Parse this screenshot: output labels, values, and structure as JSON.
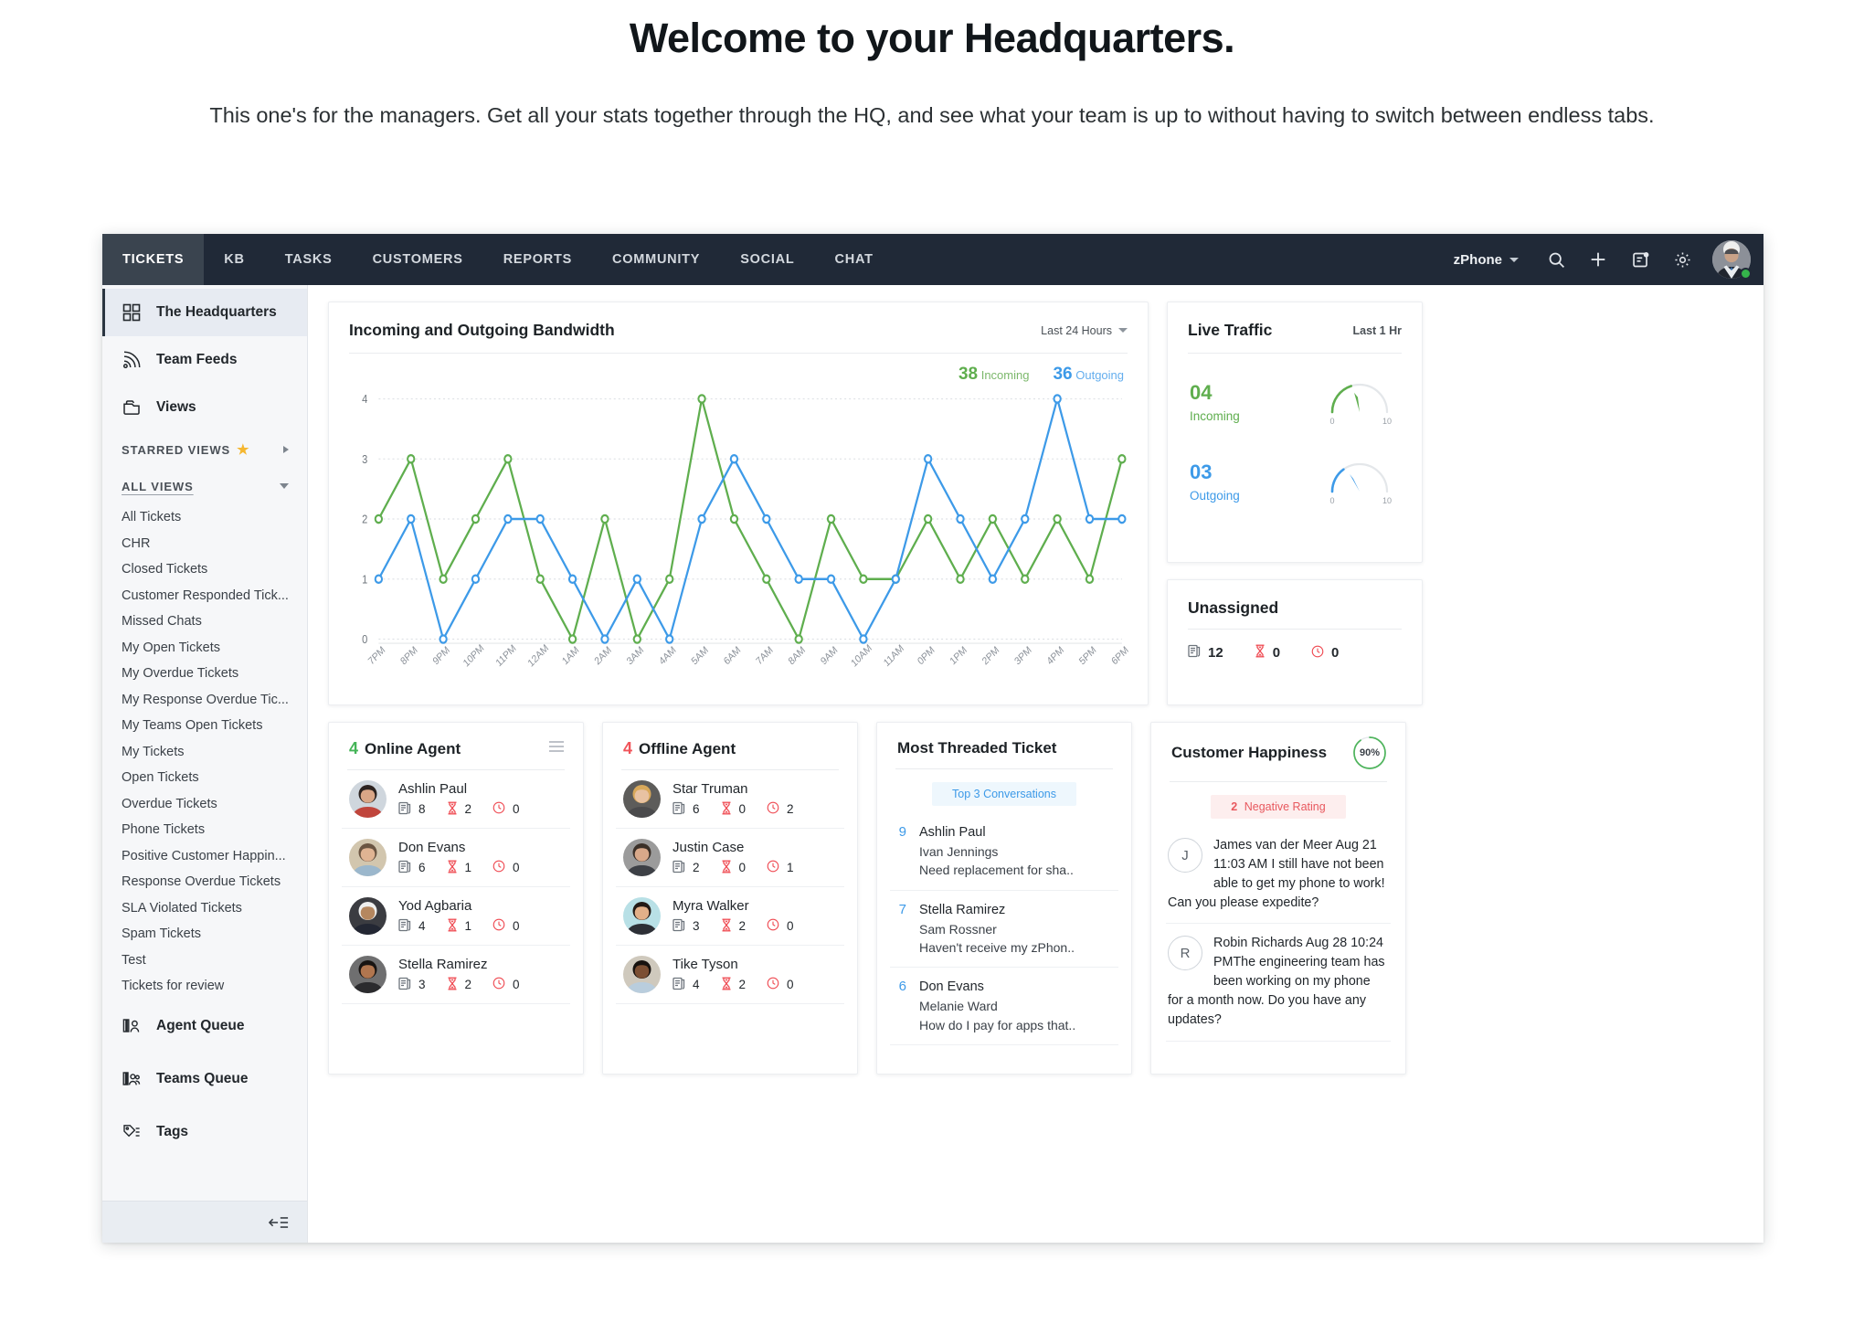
{
  "intro": {
    "title": "Welcome to your Headquarters.",
    "subtitle": "This one's for the managers. Get all your stats together through the HQ, and see what your team is up to without having to switch between endless tabs."
  },
  "topbar": {
    "tabs": [
      {
        "label": "TICKETS",
        "active": true
      },
      {
        "label": "KB",
        "active": false
      },
      {
        "label": "TASKS",
        "active": false
      },
      {
        "label": "CUSTOMERS",
        "active": false
      },
      {
        "label": "REPORTS",
        "active": false
      },
      {
        "label": "COMMUNITY",
        "active": false
      },
      {
        "label": "SOCIAL",
        "active": false
      },
      {
        "label": "CHAT",
        "active": false
      }
    ],
    "brand": "zPhone",
    "icons": [
      "search-icon",
      "plus-icon",
      "notes-icon",
      "gear-icon"
    ],
    "avatar_status": "online"
  },
  "sidebar": {
    "main_items": [
      {
        "label": "The Headquarters",
        "icon": "grid-icon",
        "active": true
      },
      {
        "label": "Team Feeds",
        "icon": "feed-icon",
        "active": false
      },
      {
        "label": "Views",
        "icon": "views-icon",
        "active": false
      }
    ],
    "starred_section": "STARRED VIEWS",
    "all_section": "ALL VIEWS",
    "views": [
      "All Tickets",
      "CHR",
      "Closed Tickets",
      "Customer Responded Tick...",
      "Missed Chats",
      "My Open Tickets",
      "My Overdue Tickets",
      "My Response Overdue Tic...",
      "My Teams Open Tickets",
      "My Tickets",
      "Open Tickets",
      "Overdue Tickets",
      "Phone Tickets",
      "Positive Customer Happin...",
      "Response Overdue Tickets",
      "SLA Violated Tickets",
      "Spam Tickets",
      "Test",
      "Tickets for review"
    ],
    "bottom_items": [
      {
        "label": "Agent Queue",
        "icon": "agent-queue-icon"
      },
      {
        "label": "Teams Queue",
        "icon": "teams-queue-icon"
      },
      {
        "label": "Tags",
        "icon": "tag-icon"
      }
    ],
    "collapse_label": "collapse-sidebar"
  },
  "bandwidth": {
    "title": "Incoming and Outgoing Bandwidth",
    "range": "Last 24 Hours",
    "legend_incoming_value": "38",
    "legend_incoming_label": "Incoming",
    "legend_outgoing_value": "36",
    "legend_outgoing_label": "Outgoing"
  },
  "chart_data": {
    "type": "line",
    "title": "Incoming and Outgoing Bandwidth",
    "xlabel": "",
    "ylabel": "",
    "ylim": [
      0,
      4
    ],
    "yticks": [
      0,
      1,
      2,
      3,
      4
    ],
    "grid": true,
    "legend": "top-right",
    "x": [
      "7PM",
      "8PM",
      "9PM",
      "10PM",
      "11PM",
      "12AM",
      "1AM",
      "2AM",
      "3AM",
      "4AM",
      "5AM",
      "6AM",
      "7AM",
      "8AM",
      "9AM",
      "10AM",
      "11AM",
      "0PM",
      "1PM",
      "2PM",
      "3PM",
      "4PM",
      "5PM",
      "6PM"
    ],
    "series": [
      {
        "name": "Incoming",
        "color": "#5fae4e",
        "total": 38,
        "values": [
          2,
          3,
          1,
          2,
          3,
          1,
          0,
          2,
          0,
          1,
          4,
          2,
          1,
          0,
          2,
          1,
          1,
          2,
          1,
          2,
          1,
          2,
          1,
          3
        ]
      },
      {
        "name": "Outgoing",
        "color": "#3d9ae8",
        "total": 36,
        "values": [
          1,
          2,
          0,
          1,
          2,
          2,
          1,
          0,
          1,
          0,
          2,
          3,
          2,
          1,
          1,
          0,
          1,
          3,
          2,
          1,
          2,
          4,
          2,
          2
        ]
      }
    ]
  },
  "live_traffic": {
    "title": "Live Traffic",
    "range": "Last 1 Hr",
    "gauges": [
      {
        "value": "04",
        "label": "Incoming",
        "min": "0",
        "max": "10",
        "color": "#5fae4e",
        "fraction": 0.4
      },
      {
        "value": "03",
        "label": "Outgoing",
        "min": "0",
        "max": "10",
        "color": "#3d9ae8",
        "fraction": 0.3
      }
    ]
  },
  "unassigned": {
    "title": "Unassigned",
    "stats": [
      {
        "icon": "ticket-icon",
        "value": "12"
      },
      {
        "icon": "hourglass-icon",
        "value": "0"
      },
      {
        "icon": "clock-icon",
        "value": "0"
      }
    ]
  },
  "online_agents": {
    "count": "4",
    "title": "Online Agent",
    "menu_icon": "hamburger-icon",
    "agents": [
      {
        "name": "Ashlin Paul",
        "tickets": "8",
        "overdue": "2",
        "due": "0"
      },
      {
        "name": "Don Evans",
        "tickets": "6",
        "overdue": "1",
        "due": "0"
      },
      {
        "name": "Yod Agbaria",
        "tickets": "4",
        "overdue": "1",
        "due": "0"
      },
      {
        "name": "Stella Ramirez",
        "tickets": "3",
        "overdue": "2",
        "due": "0"
      }
    ]
  },
  "offline_agents": {
    "count": "4",
    "title": "Offline Agent",
    "agents": [
      {
        "name": "Star Truman",
        "tickets": "6",
        "overdue": "0",
        "due": "2"
      },
      {
        "name": "Justin Case",
        "tickets": "2",
        "overdue": "0",
        "due": "1"
      },
      {
        "name": "Myra Walker",
        "tickets": "3",
        "overdue": "2",
        "due": "0"
      },
      {
        "name": "Tike Tyson",
        "tickets": "4",
        "overdue": "2",
        "due": "0"
      }
    ]
  },
  "most_threaded": {
    "title": "Most Threaded Ticket",
    "pill": "Top 3 Conversations",
    "rows": [
      {
        "count": "9",
        "agent": "Ashlin Paul",
        "customer": "Ivan Jennings",
        "subject": "Need replacement for sha.."
      },
      {
        "count": "7",
        "agent": "Stella Ramirez",
        "customer": "Sam Rossner",
        "subject": "Haven't receive my zPhon.."
      },
      {
        "count": "6",
        "agent": "Don Evans",
        "customer": "Melanie Ward",
        "subject": "How do I pay for apps that.."
      }
    ]
  },
  "customer_happiness": {
    "title": "Customer Happiness",
    "percent": "90%",
    "percent_value": 90,
    "badge_count": "2",
    "badge_label": "Negative Rating",
    "ratings": [
      {
        "initial": "J",
        "text": "James van der Meer Aug 21 11:03 AM I still have not been able to get my phone to work! Can you please expedite?"
      },
      {
        "initial": "R",
        "text": "Robin Richards  Aug 28 10:24 PMThe engineering team has been working on my phone for a month now. Do you have any updates?"
      }
    ]
  }
}
